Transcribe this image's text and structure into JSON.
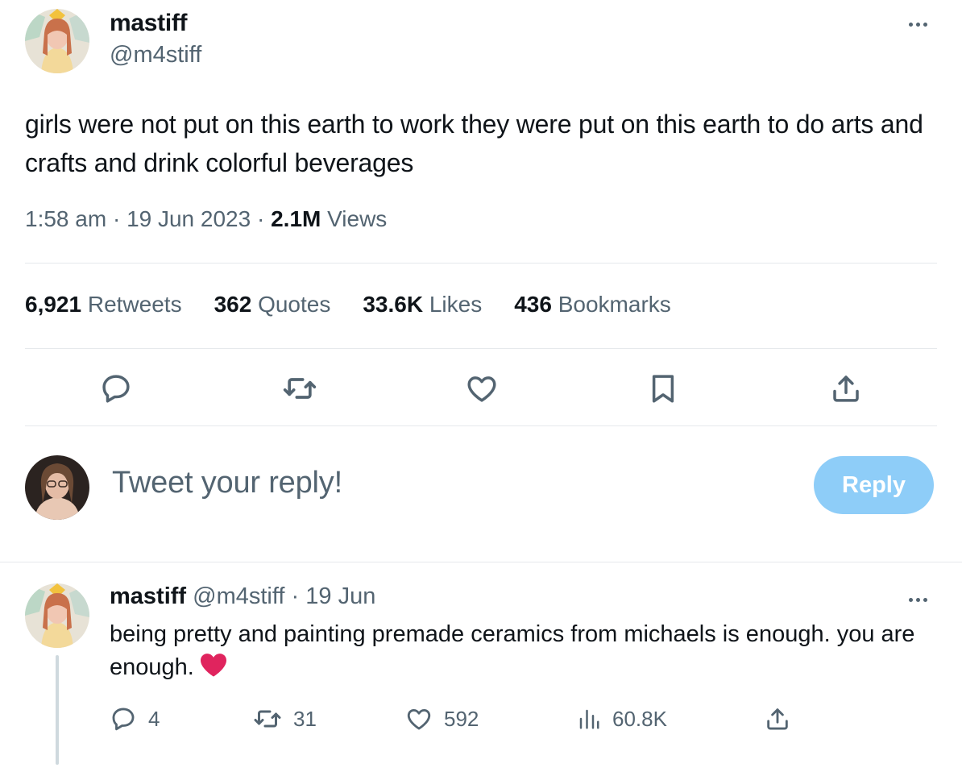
{
  "tweet": {
    "author": {
      "name": "mastiff",
      "handle": "@m4stiff"
    },
    "text": "girls were not put on this earth to work they were put on this earth to do arts and crafts and drink colorful beverages",
    "time": "1:58 am",
    "date": "19 Jun 2023",
    "views_count": "2.1M",
    "views_label": "Views",
    "stats": {
      "retweets": {
        "count": "6,921",
        "label": "Retweets"
      },
      "quotes": {
        "count": "362",
        "label": "Quotes"
      },
      "likes": {
        "count": "33.6K",
        "label": "Likes"
      },
      "bookmarks": {
        "count": "436",
        "label": "Bookmarks"
      }
    },
    "icons": [
      "reply-icon",
      "retweet-icon",
      "like-icon",
      "bookmark-icon",
      "share-icon",
      "more-icon"
    ]
  },
  "composer": {
    "placeholder": "Tweet your reply!",
    "reply_label": "Reply"
  },
  "reply": {
    "name": "mastiff",
    "handle": "@m4stiff",
    "date": "19 Jun",
    "text": "being pretty and painting premade ceramics from michaels is enough. you are enough.",
    "emoji": "red-heart-emoji",
    "counts": {
      "replies": "4",
      "retweets": "31",
      "likes": "592",
      "views": "60.8K"
    }
  },
  "colors": {
    "text": "#0f1419",
    "secondary": "#536471",
    "divider": "#e6e9ec",
    "reply_button": "#8ecdf8",
    "heart": "#e0245e"
  }
}
